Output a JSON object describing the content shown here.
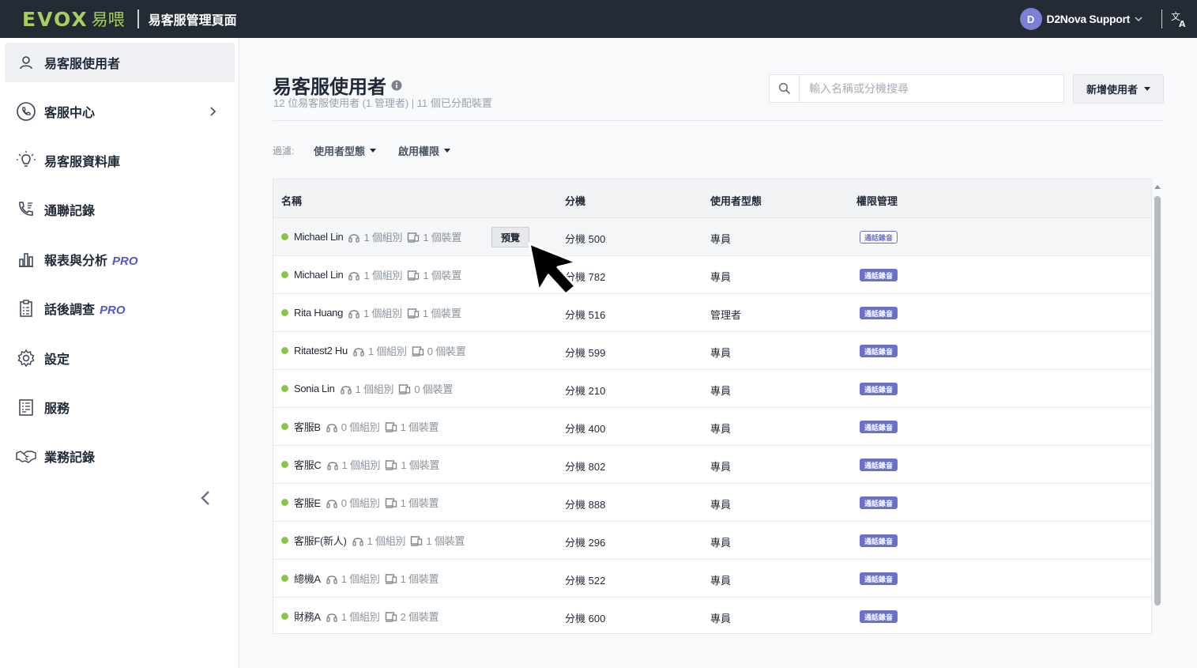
{
  "brand": {
    "logo_text": "EVOX",
    "logo_cn": "易喂",
    "logo_color": "#a6cf5b"
  },
  "header": {
    "app_title": "易客服管理頁面",
    "user_initial": "D",
    "user_name": "D2Nova Support",
    "lang_icon": "translate-icon"
  },
  "sidebar": {
    "items": [
      {
        "label": "易客服使用者",
        "icon": "user-icon",
        "active": true
      },
      {
        "label": "客服中心",
        "icon": "phone-circle-icon",
        "has_chevron": true
      },
      {
        "label": "易客服資料庫",
        "icon": "lightbulb-icon"
      },
      {
        "label": "通聯記錄",
        "icon": "call-log-icon"
      },
      {
        "label": "報表與分析",
        "icon": "bar-chart-icon",
        "pro": "PRO"
      },
      {
        "label": "話後調查",
        "icon": "clipboard-icon",
        "pro": "PRO"
      },
      {
        "label": "設定",
        "icon": "gear-icon"
      },
      {
        "label": "服務",
        "icon": "document-list-icon"
      },
      {
        "label": "業務記錄",
        "icon": "handshake-icon"
      }
    ]
  },
  "main": {
    "title": "易客服使用者",
    "subtitle": "12 位易客服使用者 (1 管理者) | 11 個已分配裝置",
    "search_placeholder": "輸入名稱或分機搜尋",
    "add_button": "新增使用者",
    "filter_label": "過濾:",
    "filters": [
      "使用者型態",
      "啟用權限"
    ]
  },
  "table": {
    "headers": {
      "name": "名稱",
      "ext": "分機",
      "type": "使用者型態",
      "perm": "權限管理"
    },
    "preview_label": "預覽",
    "badge_label": "通話錄音",
    "rows": [
      {
        "name": "Michael Lin",
        "groups": "1 個組別",
        "devices": "1 個裝置",
        "ext": "分機 500",
        "type": "專員"
      },
      {
        "name": "Michael Lin",
        "groups": "1 個組別",
        "devices": "1 個裝置",
        "ext": "分機 782",
        "type": "專員"
      },
      {
        "name": "Rita Huang",
        "groups": "1 個組別",
        "devices": "1 個裝置",
        "ext": "分機 516",
        "type": "管理者"
      },
      {
        "name": "Ritatest2 Hu",
        "groups": "1 個組別",
        "devices": "0 個裝置",
        "ext": "分機 599",
        "type": "專員"
      },
      {
        "name": "Sonia Lin",
        "groups": "1 個組別",
        "devices": "0 個裝置",
        "ext": "分機 210",
        "type": "專員"
      },
      {
        "name": "客服B",
        "groups": "0 個組別",
        "devices": "1 個裝置",
        "ext": "分機 400",
        "type": "專員"
      },
      {
        "name": "客服C",
        "groups": "1 個組別",
        "devices": "1 個裝置",
        "ext": "分機 802",
        "type": "專員"
      },
      {
        "name": "客服E",
        "groups": "0 個組別",
        "devices": "1 個裝置",
        "ext": "分機 888",
        "type": "專員"
      },
      {
        "name": "客服F(新人)",
        "groups": "1 個組別",
        "devices": "1 個裝置",
        "ext": "分機 296",
        "type": "專員"
      },
      {
        "name": "總機A",
        "groups": "1 個組別",
        "devices": "1 個裝置",
        "ext": "分機 522",
        "type": "專員"
      },
      {
        "name": "財務A",
        "groups": "1 個組別",
        "devices": "2 個裝置",
        "ext": "分機 600",
        "type": "專員"
      }
    ]
  },
  "colors": {
    "accent": "#5457c7",
    "badge": "#6b70c9",
    "online": "#8bc34a",
    "topbar": "#242b35"
  }
}
